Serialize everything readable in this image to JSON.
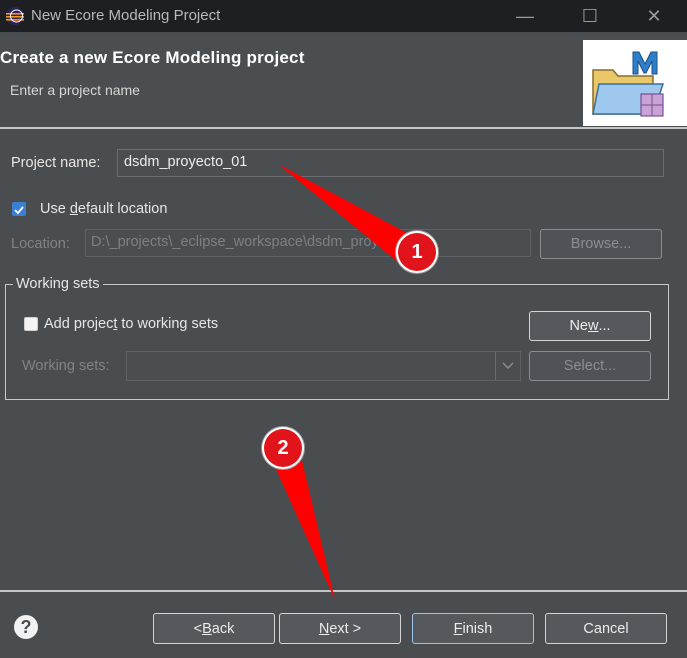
{
  "window": {
    "title": "New Ecore Modeling Project",
    "controls": [
      "minimize-icon",
      "maximize-icon",
      "close-icon"
    ]
  },
  "header": {
    "title": "Create a new Ecore Modeling project",
    "subtitle": "Enter a project name"
  },
  "form": {
    "project_name_label": "Project name:",
    "project_name_value": "dsdm_proyecto_01",
    "use_default_location": {
      "label": "Use default location",
      "checked": true
    },
    "location_label": "Location:",
    "location_value": "D:\\_projects\\_eclipse_workspace\\dsdm_proyecto_01",
    "browse_label": "Browse..."
  },
  "working_sets": {
    "legend": "Working sets",
    "add_label": "Add project to working sets",
    "add_checked": false,
    "new_label": "New...",
    "sets_label": "Working sets:",
    "sets_value": "",
    "select_label": "Select..."
  },
  "footer": {
    "help_icon": "help-icon",
    "back_label": "< Back",
    "next_label": "Next >",
    "finish_label": "Finish",
    "cancel_label": "Cancel"
  },
  "annotations": {
    "marker_1": "1",
    "marker_2": "2",
    "arrow_color": "#ff0000"
  }
}
